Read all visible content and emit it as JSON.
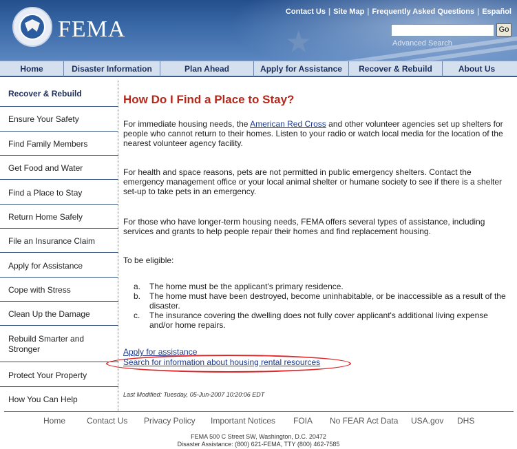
{
  "header": {
    "brand": "FEMA",
    "top_links": [
      "Contact Us",
      "Site Map",
      "Frequently Asked Questions",
      "Español"
    ],
    "search": {
      "value": "",
      "placeholder": ""
    },
    "go_label": "Go",
    "advanced_search": "Advanced Search"
  },
  "nav": [
    "Home",
    "Disaster Information",
    "Plan Ahead",
    "Apply for Assistance",
    "Recover & Rebuild",
    "About Us"
  ],
  "sidebar": {
    "title": "Recover & Rebuild",
    "items": [
      "Ensure Your Safety",
      "Find Family Members",
      "Get Food and Water",
      "Find a Place to Stay",
      "Return Home Safely",
      "File an Insurance Claim",
      "Apply for Assistance",
      "Cope with Stress",
      "Clean Up the Damage",
      "Rebuild Smarter and Stronger",
      "Protect Your Property",
      "How You Can Help"
    ]
  },
  "main": {
    "title": "How Do I Find a Place to Stay?",
    "p1_before": "For immediate housing needs, the ",
    "p1_link": "American Red Cross",
    "p1_after": " and other volunteer agencies set up shelters for people who cannot return to their homes. Listen to your radio or watch local media for the location of the nearest volunteer agency facility.",
    "p2": "For health and space reasons, pets are not permitted in public emergency shelters. Contact the emergency management office or your local animal shelter or humane society to see if there is a shelter set-up to take pets in an emergency.",
    "p3": "For those who have longer-term housing needs, FEMA offers several types of assistance, including services and grants to help people repair their homes and find replacement housing.",
    "eligible": "To be eligible:",
    "list": [
      {
        "mark": "a.",
        "text": "The home must be the applicant's primary residence."
      },
      {
        "mark": "b.",
        "text": "The home must have been destroyed, become uninhabitable, or be inaccessible as a result of the disaster."
      },
      {
        "mark": "c.",
        "text": "The insurance covering the dwelling does not fully cover applicant's additional living expense and/or home repairs."
      }
    ],
    "apply_link": "Apply for assistance",
    "search_link": "Search for information about housing rental resources",
    "last_modified": "Last Modified: Tuesday, 05-Jun-2007 10:20:06 EDT"
  },
  "footer": {
    "links": [
      "Home",
      "Contact Us",
      "Privacy Policy",
      "Important Notices",
      "FOIA",
      "No FEAR Act Data",
      "USA.gov",
      "DHS"
    ],
    "address": "FEMA 500 C Street SW, Washington, D.C. 20472",
    "assistance": "Disaster Assistance: (800) 621-FEMA, TTY (800) 462-7585"
  },
  "colors": {
    "header_blue": "#244f8d",
    "title_red": "#b5281a",
    "annotation_red": "#e0282a",
    "link_blue": "#1d3b8c"
  }
}
